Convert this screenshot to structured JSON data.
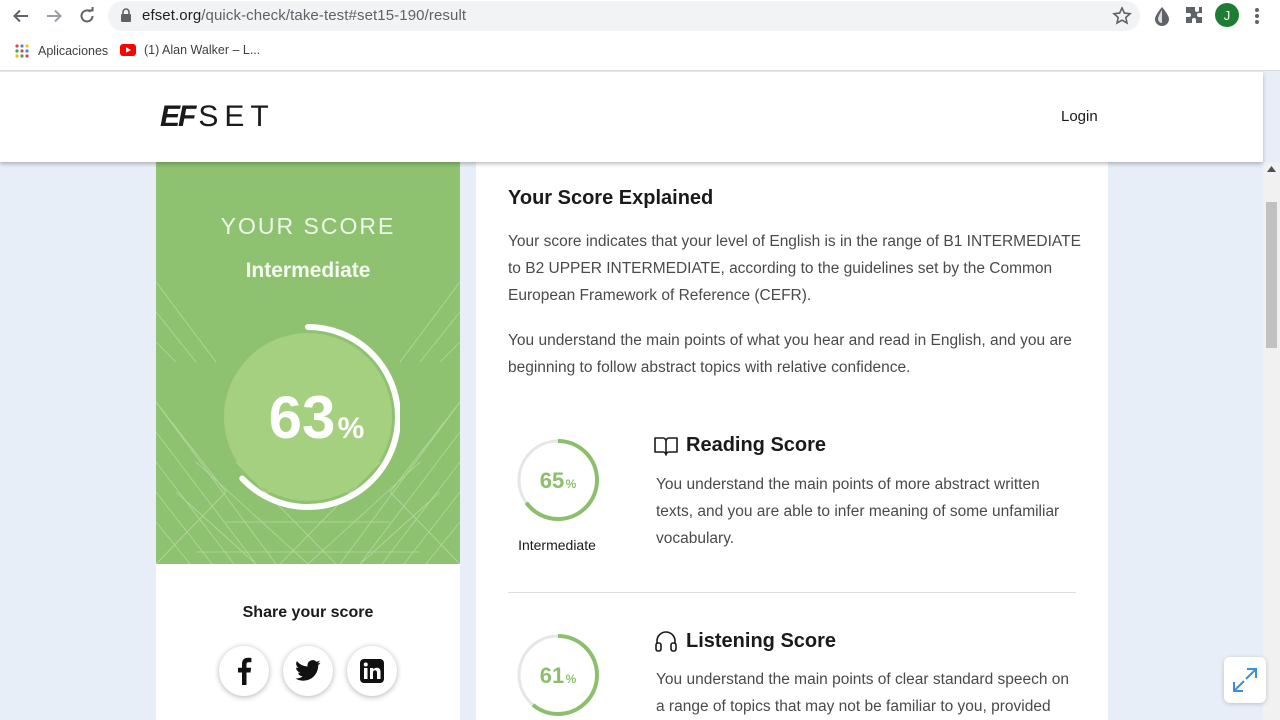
{
  "browser": {
    "url_host": "efset.org",
    "url_path": "/quick-check/take-test#set15-190/result",
    "bookmarks": [
      {
        "label": "Aplicaciones",
        "icon": "apps-grid-icon"
      },
      {
        "label": "(1) Alan Walker – L...",
        "icon": "youtube-icon"
      }
    ],
    "profile_initial": "J"
  },
  "header": {
    "logo_ef": "EF",
    "logo_set": "SET",
    "login_label": "Login"
  },
  "score": {
    "title": "YOUR SCORE",
    "level": "Intermediate",
    "value": 63,
    "value_text": "63",
    "percent_sign": "%",
    "share_label": "Share your score",
    "social": [
      "facebook-icon",
      "twitter-icon",
      "linkedin-icon"
    ]
  },
  "explained": {
    "heading": "Your Score Explained",
    "paragraph1": "Your score indicates that your level of English is in the range of B1 INTERMEDIATE to B2 UPPER INTERMEDIATE, according to the guidelines set by the Common European Framework of Reference (CEFR).",
    "paragraph2": "You understand the main points of what you hear and read in English, and you are beginning to follow abstract topics with relative confidence."
  },
  "reading": {
    "heading": "Reading Score",
    "value": 65,
    "value_text": "65",
    "percent_sign": "%",
    "level": "Intermediate",
    "description": "You understand the main points of more abstract written texts, and you are able to infer meaning of some unfamiliar vocabulary."
  },
  "listening": {
    "heading": "Listening Score",
    "value": 61,
    "value_text": "61",
    "percent_sign": "%",
    "description": "You understand the main points of clear standard speech on a range of topics that may not be familiar to you, provided"
  },
  "colors": {
    "green_panel": "#8fc270",
    "ring_green": "#8cbf6c",
    "circle_fill": "#a5d07f"
  }
}
